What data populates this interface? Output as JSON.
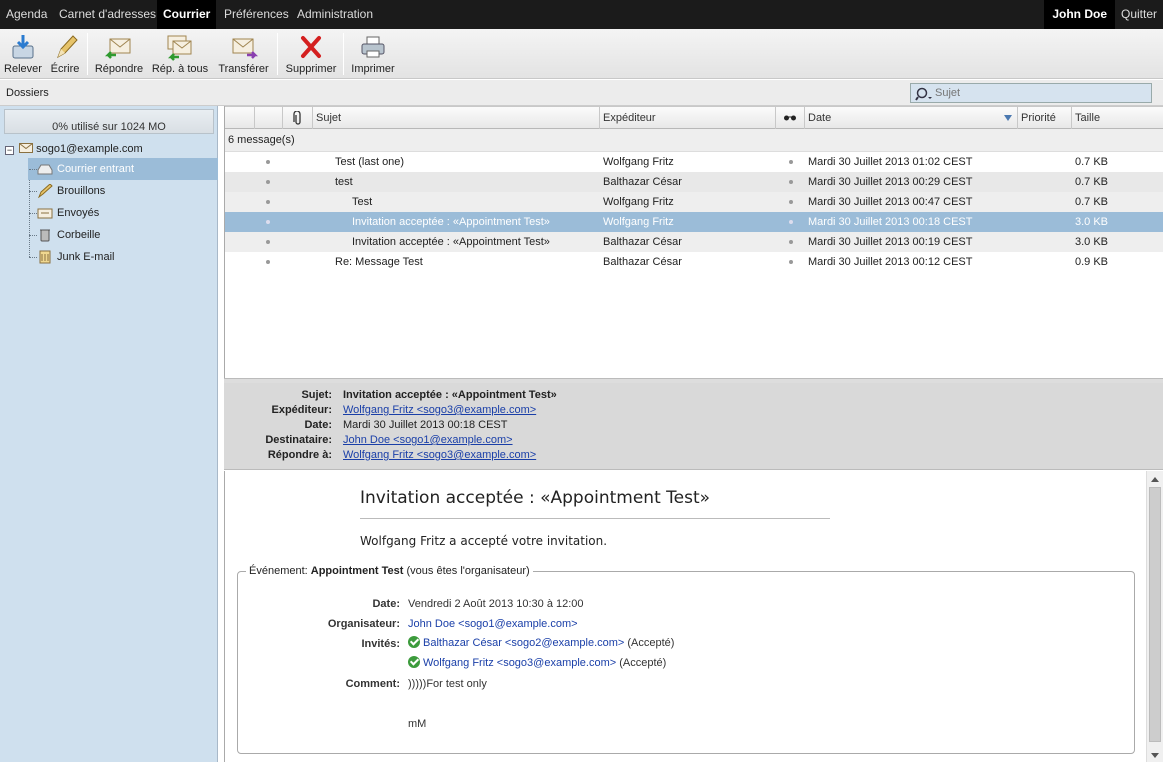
{
  "nav": {
    "items": [
      "Agenda",
      "Carnet d'adresses",
      "Courrier",
      "Préférences",
      "Administration"
    ],
    "active": "Courrier",
    "user": "John Doe",
    "quit": "Quitter"
  },
  "toolbar": {
    "get_mail": "Relever",
    "write": "Écrire",
    "reply": "Répondre",
    "reply_all": "Rép. à tous",
    "forward": "Transférer",
    "delete": "Supprimer",
    "print": "Imprimer"
  },
  "folders_bar": {
    "title": "Dossiers",
    "search_placeholder": "Sujet"
  },
  "sidebar": {
    "quota": "0% utilisé sur 1024 MO",
    "account": "sogo1@example.com",
    "folders": [
      {
        "label": "Courrier entrant",
        "icon": "inbox-icon"
      },
      {
        "label": "Brouillons",
        "icon": "pencil-icon"
      },
      {
        "label": "Envoyés",
        "icon": "sent-icon"
      },
      {
        "label": "Corbeille",
        "icon": "trash-icon"
      },
      {
        "label": "Junk E-mail",
        "icon": "junk-icon"
      }
    ],
    "selected": "Courrier entrant"
  },
  "list": {
    "columns": {
      "subject": "Sujet",
      "sender": "Expéditeur",
      "date": "Date",
      "priority": "Priorité",
      "size": "Taille"
    },
    "count": "6 message(s)",
    "rows": [
      {
        "subject": "Test (last one)",
        "sender": "Wolfgang Fritz",
        "date": "Mardi 30 Juillet 2013 01:02 CEST",
        "size": "0.7 KB"
      },
      {
        "subject": "test",
        "sender": "Balthazar César",
        "date": "Mardi 30 Juillet 2013 00:29 CEST",
        "size": "0.7 KB"
      },
      {
        "subject": "Test",
        "sender": "Wolfgang Fritz",
        "date": "Mardi 30 Juillet 2013 00:47 CEST",
        "size": "0.7 KB"
      },
      {
        "subject": "Invitation acceptée : «Appointment Test»",
        "sender": "Wolfgang Fritz",
        "date": "Mardi 30 Juillet 2013 00:18 CEST",
        "size": "3.0 KB"
      },
      {
        "subject": "Invitation acceptée : «Appointment Test»",
        "sender": "Balthazar César",
        "date": "Mardi 30 Juillet 2013 00:19 CEST",
        "size": "3.0 KB"
      },
      {
        "subject": "Re: Message Test",
        "sender": "Balthazar César",
        "date": "Mardi 30 Juillet 2013 00:12 CEST",
        "size": "0.9 KB"
      }
    ]
  },
  "message": {
    "labels": {
      "subject": "Sujet:",
      "sender": "Expéditeur:",
      "date": "Date:",
      "recipient": "Destinataire:",
      "reply_to": "Répondre à:"
    },
    "subject": "Invitation acceptée : «Appointment Test»",
    "sender": "Wolfgang Fritz <sogo3@example.com>",
    "date": "Mardi 30 Juillet 2013 00:18 CEST",
    "recipient": "John Doe <sogo1@example.com>",
    "reply_to": "Wolfgang Fritz <sogo3@example.com>",
    "body_title": "Invitation acceptée : «Appointment Test»",
    "body_intro": "Wolfgang Fritz a accepté votre invitation.",
    "event": {
      "legend_prefix": "Événement:",
      "legend_name": "Appointment Test",
      "legend_suffix": "(vous êtes l'organisateur)",
      "date_label": "Date:",
      "date": "Vendredi 2 Août 2013 10:30 à 12:00",
      "organizer_label": "Organisateur:",
      "organizer": "John Doe <sogo1@example.com>",
      "attendees_label": "Invités:",
      "attendees": [
        {
          "name": "Balthazar César <sogo2@example.com>",
          "status": "(Accepté)"
        },
        {
          "name": "Wolfgang Fritz <sogo3@example.com>",
          "status": "(Accepté)"
        }
      ],
      "comment_label": "Comment:",
      "comment": ")))))For test only",
      "comment_extra": "mM"
    }
  }
}
